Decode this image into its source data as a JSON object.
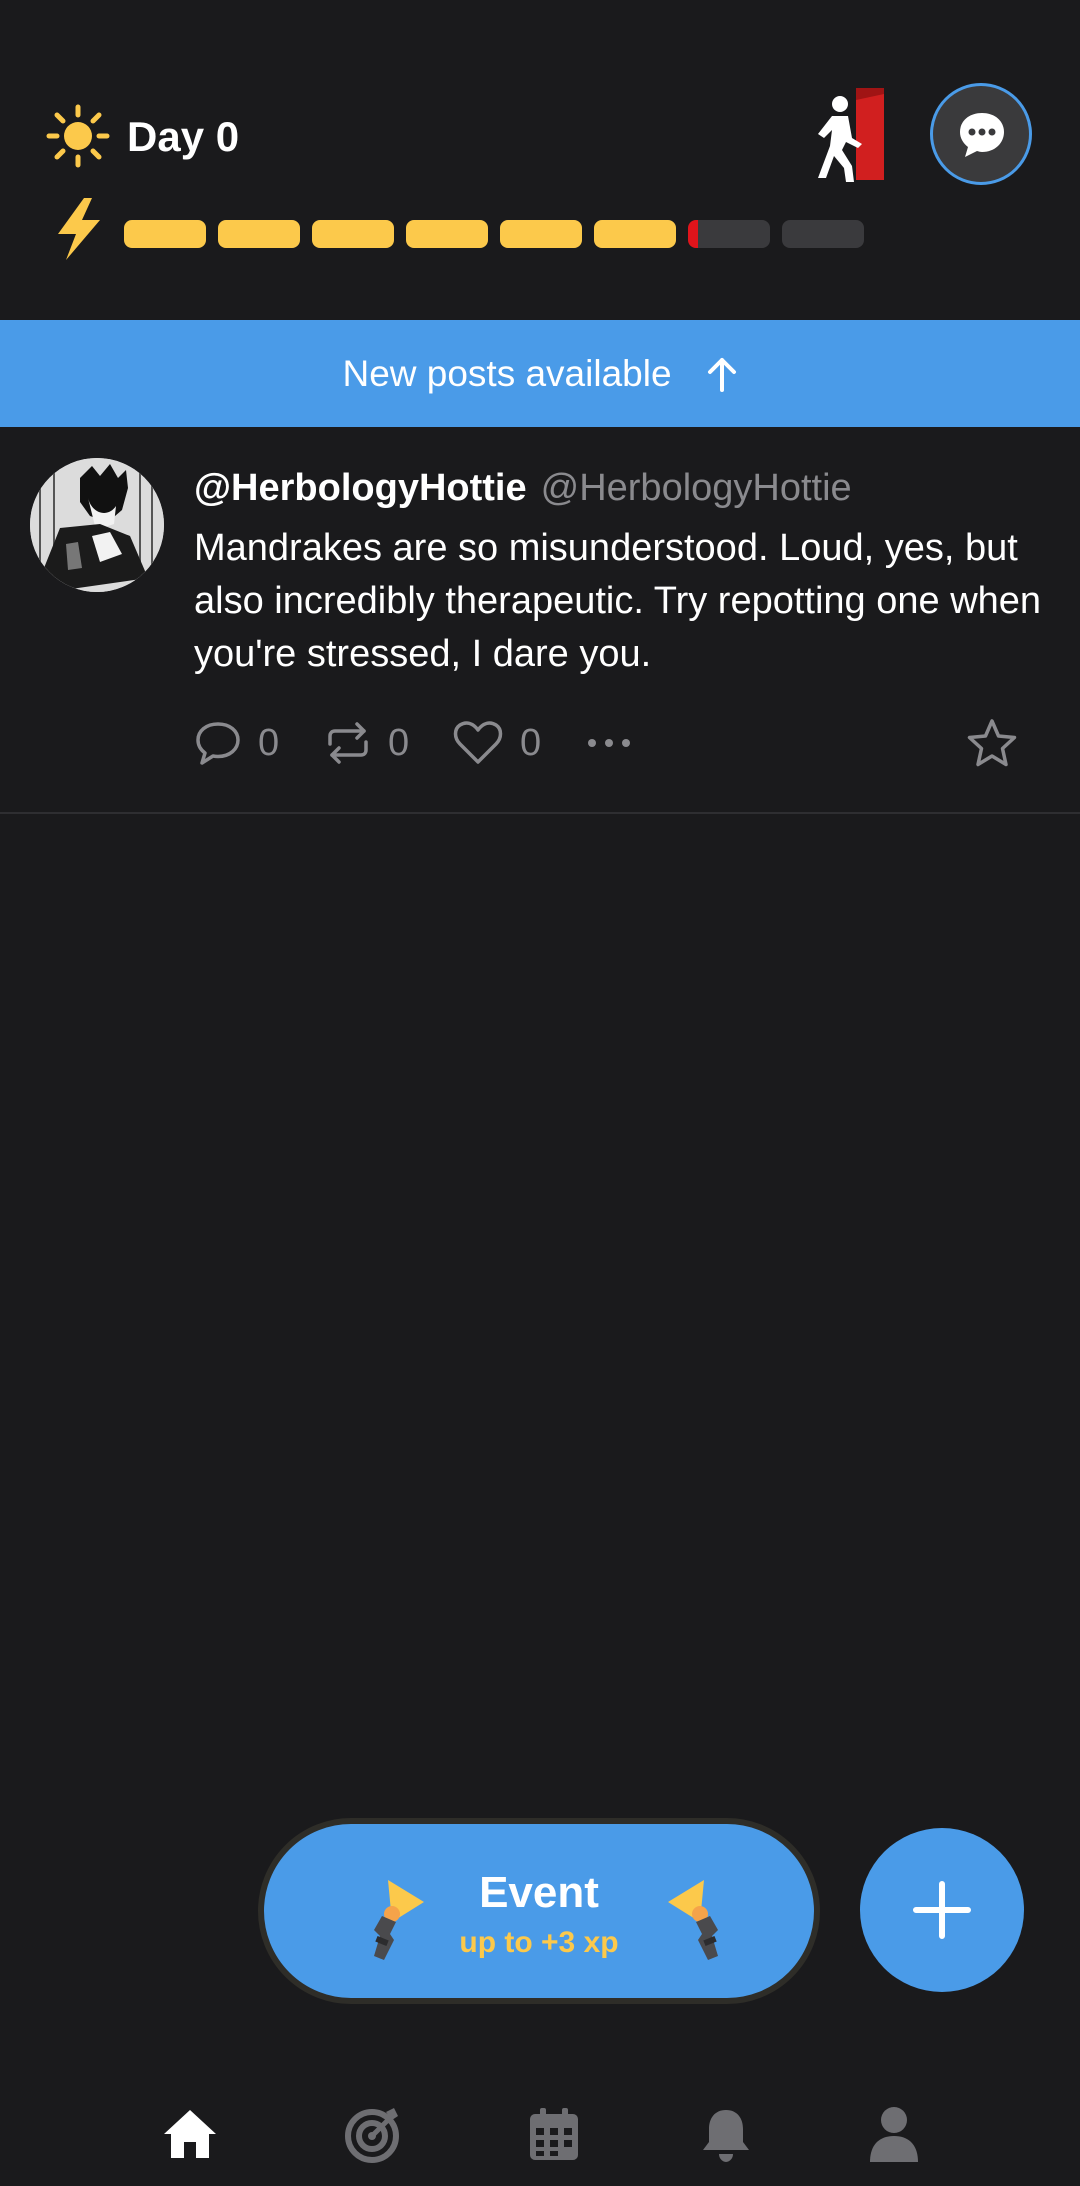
{
  "header": {
    "day_label": "Day 0",
    "energy": {
      "total_segments": 8,
      "full_segments": 6,
      "partial_segment_fill": 0.12
    },
    "icons": [
      "sun-icon",
      "exit-door-icon",
      "chat-bubble-icon",
      "lightning-bolt-icon"
    ]
  },
  "banner": {
    "label": "New posts available"
  },
  "post": {
    "display_name": "@HerbologyHottie",
    "handle": "@HerbologyHottie",
    "text": "Mandrakes are so misunderstood. Loud, yes, but also incredibly therapeutic. Try repotting one when you're stressed, I dare you.",
    "replies": "0",
    "reposts": "0",
    "likes": "0"
  },
  "event_button": {
    "title": "Event",
    "subtitle": "up to +3 xp"
  },
  "bottom_nav": {
    "items": [
      "home-icon",
      "target-icon",
      "calendar-icon",
      "bell-icon",
      "profile-icon"
    ],
    "active": "home-icon"
  },
  "colors": {
    "accent": "#4a9be8",
    "energy": "#fcc94b",
    "background": "#1a1a1c",
    "danger": "#e0141b"
  }
}
